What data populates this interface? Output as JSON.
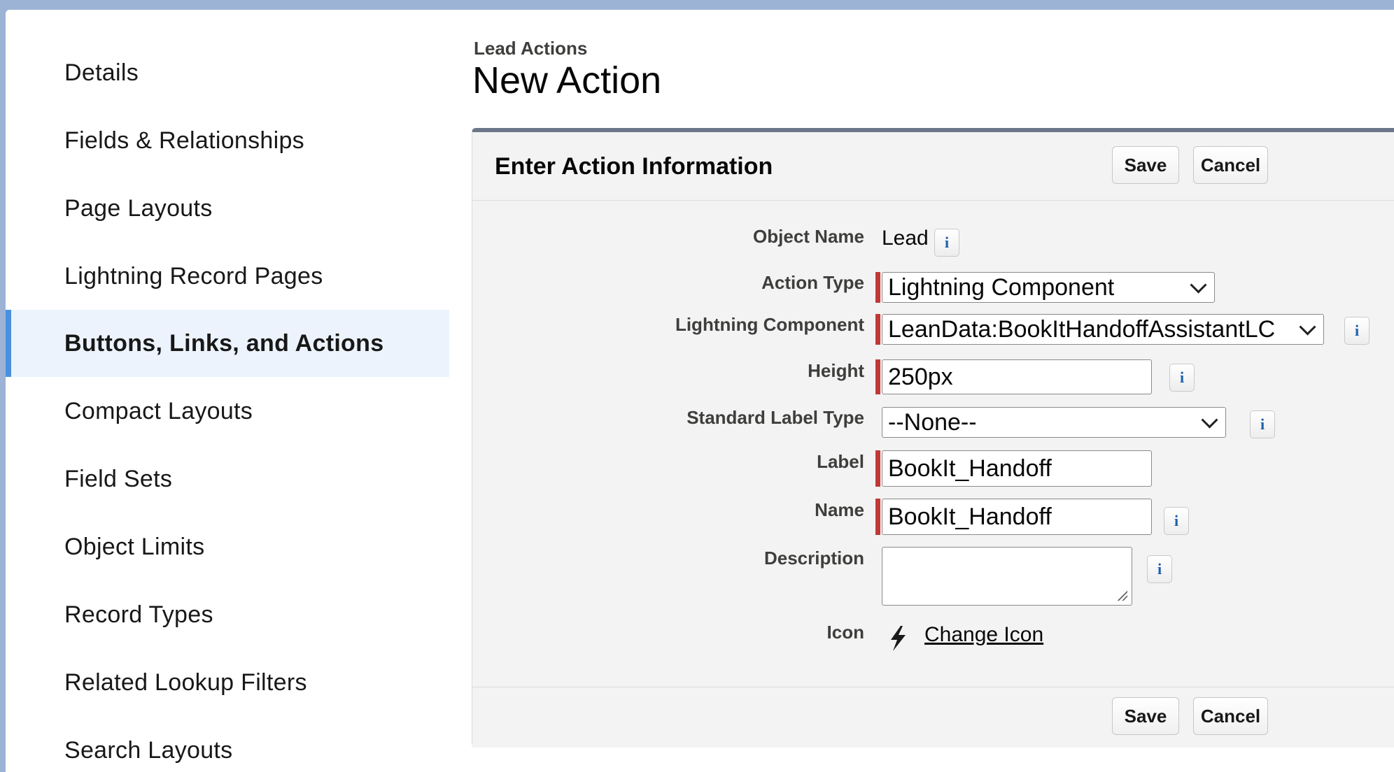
{
  "sidebar": {
    "items": [
      {
        "label": "Details"
      },
      {
        "label": "Fields & Relationships"
      },
      {
        "label": "Page Layouts"
      },
      {
        "label": "Lightning Record Pages"
      },
      {
        "label": "Buttons, Links, and Actions",
        "active": true
      },
      {
        "label": "Compact Layouts"
      },
      {
        "label": "Field Sets"
      },
      {
        "label": "Object Limits"
      },
      {
        "label": "Record Types"
      },
      {
        "label": "Related Lookup Filters"
      },
      {
        "label": "Search Layouts"
      }
    ]
  },
  "header": {
    "breadcrumb": "Lead Actions",
    "title": "New Action"
  },
  "panel": {
    "title": "Enter Action Information",
    "save_label": "Save",
    "cancel_label": "Cancel"
  },
  "form": {
    "object_name": {
      "label": "Object Name",
      "value": "Lead"
    },
    "action_type": {
      "label": "Action Type",
      "value": "Lightning Component"
    },
    "lightning_component": {
      "label": "Lightning Component",
      "value": "LeanData:BookItHandoffAssistantLC"
    },
    "height": {
      "label": "Height",
      "value": "250px"
    },
    "standard_label_type": {
      "label": "Standard Label Type",
      "value": "--None--"
    },
    "label": {
      "label": "Label",
      "value": "BookIt_Handoff"
    },
    "name": {
      "label": "Name",
      "value": "BookIt_Handoff"
    },
    "description": {
      "label": "Description",
      "value": ""
    },
    "icon": {
      "label": "Icon",
      "link": "Change Icon",
      "icon_name": "lightning-bolt-icon"
    },
    "info_glyph": "i"
  },
  "colors": {
    "required_bar": "#c23934",
    "active_nav_bar": "#4a90e2",
    "active_nav_bg": "#ecf3fd",
    "info_glyph": "#1b5faa"
  }
}
